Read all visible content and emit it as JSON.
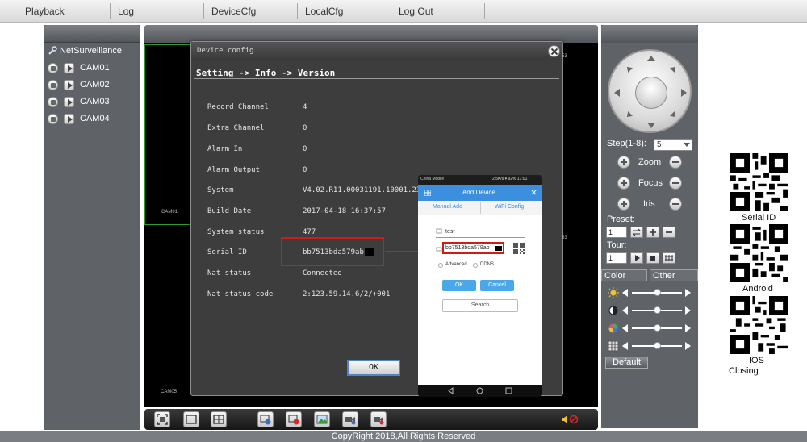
{
  "menu": {
    "items": [
      "Playback",
      "Log",
      "DeviceCfg",
      "LocalCfg",
      "Log Out"
    ]
  },
  "left": {
    "root": "NetSurveillance",
    "cameras": [
      "CAM01",
      "CAM02",
      "CAM03",
      "CAM04"
    ]
  },
  "video": {
    "tile_labels": [
      "CAM01",
      "CAM05"
    ]
  },
  "dialog": {
    "title": "Device config",
    "breadcrumb": "Setting -> Info -> Version",
    "rows": [
      {
        "label": "Record Channel",
        "value": "4"
      },
      {
        "label": "Extra Channel",
        "value": "0"
      },
      {
        "label": "Alarm In",
        "value": "0"
      },
      {
        "label": "Alarm Output",
        "value": "0"
      },
      {
        "label": "System",
        "value": "V4.02.R11.00031191.10001.231"
      },
      {
        "label": "Build Date",
        "value": "2017-04-18 16:37:57"
      },
      {
        "label": "System status",
        "value": "477"
      },
      {
        "label": "Serial ID",
        "value": "bb7513bda579ab"
      },
      {
        "label": "Nat status",
        "value": "Connected"
      },
      {
        "label": "Nat status code",
        "value": "2:123.59.14.6/2/+001"
      }
    ],
    "ok_label": "OK"
  },
  "phone": {
    "status_left": "China Mobile",
    "status_right": "2.5K/s ▾ 92% 17:01",
    "header_title": "Add Device",
    "tab_manual": "Manual Add",
    "tab_wifi": "WiFi Config",
    "name_value": "test",
    "serial_value": "bb7513bda579ab",
    "advanced": "Advanced",
    "ddns": "DDNS",
    "ok": "OK",
    "cancel": "Cancel",
    "search": "Search"
  },
  "right": {
    "step_label": "Step(1-8):",
    "step_value": "5",
    "zoom": "Zoom",
    "focus": "Focus",
    "iris": "Iris",
    "preset_label": "Preset:",
    "preset_value": "1",
    "tour_label": "Tour:",
    "tour_value": "1",
    "tab_color": "Color",
    "tab_other": "Other",
    "default_label": "Default",
    "sliders": [
      0.5,
      0.5,
      0.5,
      0.5
    ]
  },
  "qr": {
    "labels": [
      "Serial ID",
      "Android",
      "IOS"
    ],
    "closing": "Closing"
  },
  "footer": {
    "copyright": "CopyRight 2018,All Rights Reserved"
  },
  "colors": {
    "panel": "#5f6368",
    "highlight": "#d11a1a",
    "accent": "#3b8fde"
  }
}
